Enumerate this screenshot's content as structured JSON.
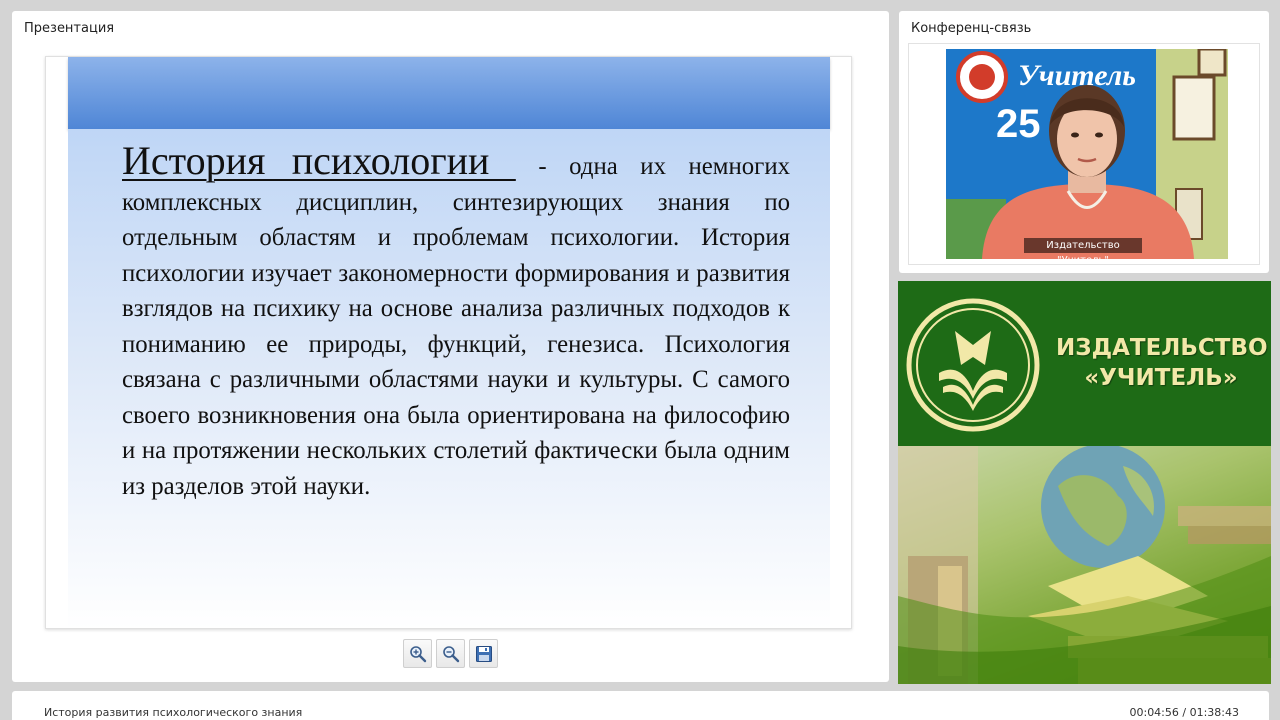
{
  "presentation": {
    "title": "Презентация",
    "slide": {
      "heading": "История психологии ",
      "body": " - одна их немногих комплексных дисциплин, синтезирующих знания по отдельным областям и проблемам психологии. История психологии изучает закономерности формирования и развития взглядов на психику на основе анализа различных подходов к пониманию ее природы, функций, генезиса. Психология связана с различными областями науки и культуры. С самого своего возникновения она была ориентирована на философию и на протяжении нескольких столетий фактически была одним из разделов этой науки."
    },
    "toolbar": {
      "zoom_in_icon": "zoom-in-icon",
      "zoom_out_icon": "zoom-out-icon",
      "save_icon": "floppy-disk-icon"
    }
  },
  "conference": {
    "title": "Конференц-связь",
    "video_caption": "Издательство \"Учитель\"",
    "video_sign": "Учитель",
    "video_number": "25"
  },
  "publisher": {
    "name_line1": "ИЗДАТЕЛЬСТВО",
    "name_line2": "«УЧИТЕЛЬ»"
  },
  "footer": {
    "lecture_title": "История развития психологического знания",
    "time": "00:04:56 / 01:38:43"
  },
  "colors": {
    "publisher_green": "#1e6b16",
    "publisher_gold": "#f2e8a8",
    "slide_band": "#4f86d6"
  }
}
